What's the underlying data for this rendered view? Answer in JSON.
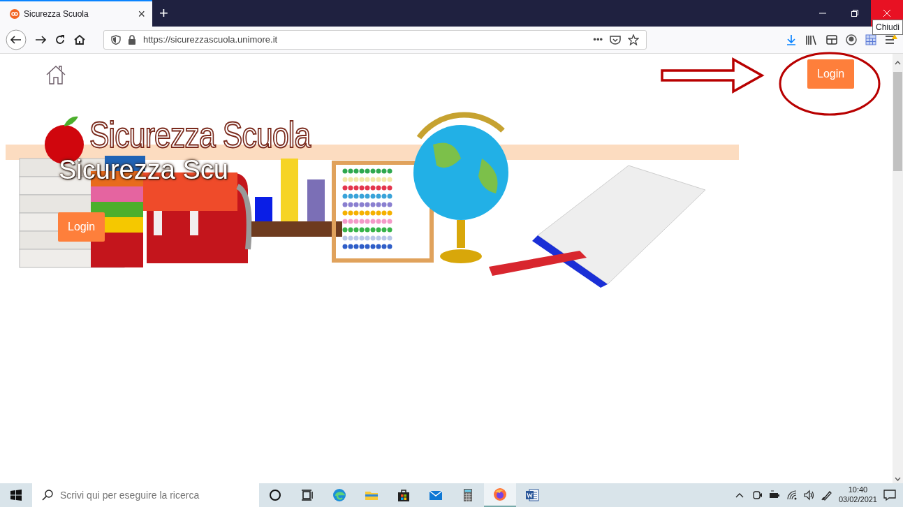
{
  "browser": {
    "tabs": [
      {
        "title": "Sicurezza Scuola",
        "selected": true
      }
    ],
    "close_tab": "×",
    "new_tab": "+",
    "url": "https://sicurezzascuola.unimore.it",
    "page_actions": "•••",
    "tooltip": "Chiudi"
  },
  "page": {
    "top_button": "Login",
    "logo_title": "Sicurezza Scuola",
    "hero_heading": "Sicurezza Scu",
    "hero_button": "Login"
  },
  "annotations": [
    {
      "kind": "arrow"
    },
    {
      "kind": "ellipse"
    }
  ],
  "taskbar": {
    "search": {
      "placeholder": "Scrivi qui per eseguire la ricerca"
    },
    "apps": [
      {
        "kind": "cortana",
        "selected": false
      },
      {
        "kind": "taskview",
        "selected": false
      },
      {
        "kind": "edge",
        "selected": false
      },
      {
        "kind": "folder",
        "selected": false
      },
      {
        "kind": "store",
        "selected": false
      },
      {
        "kind": "mail",
        "selected": false
      },
      {
        "kind": "calculator",
        "selected": false
      },
      {
        "kind": "firefox",
        "selected": true
      },
      {
        "kind": "word",
        "selected": false
      }
    ],
    "clock": {
      "time": "10:40",
      "date": "03/02/2021"
    }
  }
}
